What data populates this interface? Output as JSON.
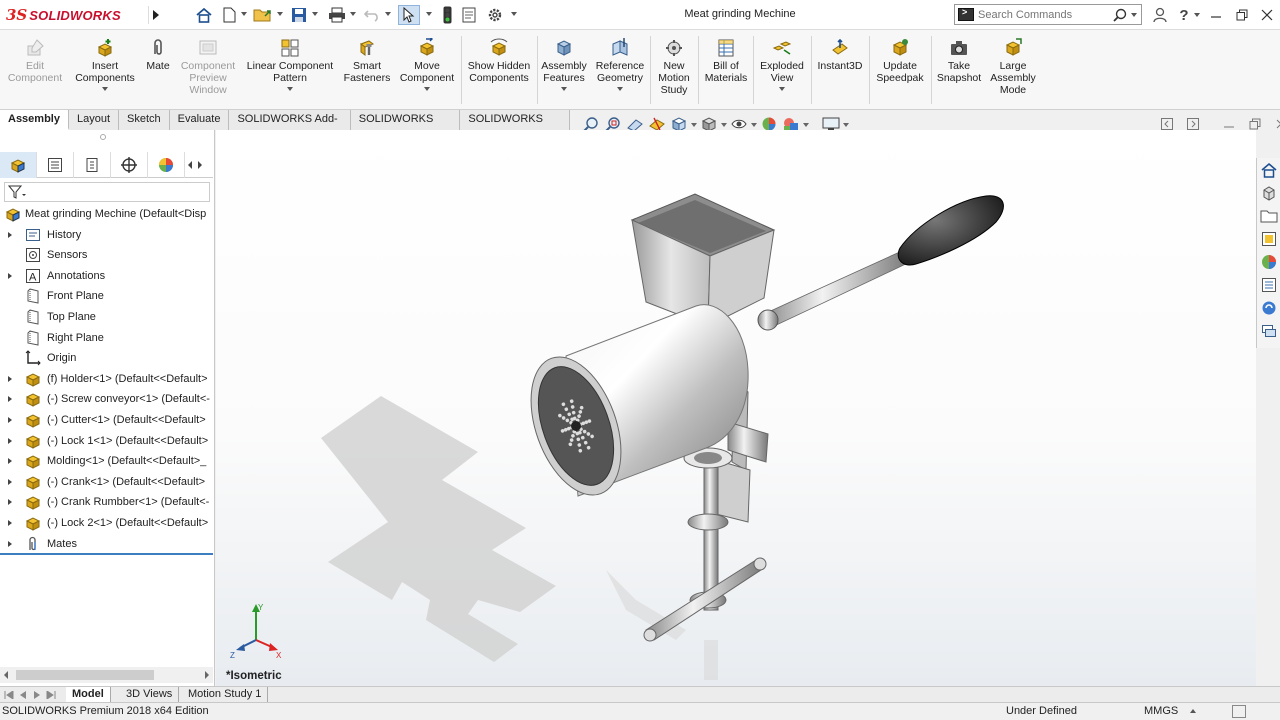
{
  "app": {
    "logo_prefix": "3S",
    "logo_name": "SOLIDWORKS",
    "document_title": "Meat grinding Mechine"
  },
  "search": {
    "placeholder": "Search Commands"
  },
  "toolbar": [
    {
      "label": "Edit Component",
      "icon": "edit-component-icon",
      "enabled": false
    },
    {
      "label": "Insert Components",
      "icon": "insert-components-icon",
      "enabled": true
    },
    {
      "label": "Mate",
      "icon": "mate-paperclip-icon",
      "enabled": true
    },
    {
      "label": "Component Preview Window",
      "icon": "preview-window-icon",
      "enabled": false
    },
    {
      "label": "Linear Component Pattern",
      "icon": "linear-pattern-icon",
      "enabled": true
    },
    {
      "label": "Smart Fasteners",
      "icon": "smart-fasteners-icon",
      "enabled": true
    },
    {
      "label": "Move Component",
      "icon": "move-component-icon",
      "enabled": true
    },
    {
      "label": "Show Hidden Components",
      "icon": "show-hidden-icon",
      "enabled": true
    },
    {
      "label": "Assembly Features",
      "icon": "assembly-features-icon",
      "enabled": true
    },
    {
      "label": "Reference Geometry",
      "icon": "reference-geometry-icon",
      "enabled": true
    },
    {
      "label": "New Motion Study",
      "icon": "motion-study-icon",
      "enabled": true
    },
    {
      "label": "Bill of Materials",
      "icon": "bom-icon",
      "enabled": true
    },
    {
      "label": "Exploded View",
      "icon": "exploded-view-icon",
      "enabled": true
    },
    {
      "label": "Instant3D",
      "icon": "instant3d-icon",
      "enabled": true
    },
    {
      "label": "Update Speedpak",
      "icon": "speedpak-icon",
      "enabled": true
    },
    {
      "label": "Take Snapshot",
      "icon": "camera-icon",
      "enabled": true
    },
    {
      "label": "Large Assembly Mode",
      "icon": "large-assembly-icon",
      "enabled": true
    }
  ],
  "tabs": [
    "Assembly",
    "Layout",
    "Sketch",
    "Evaluate",
    "SOLIDWORKS Add-Ins",
    "SOLIDWORKS MBD",
    "SOLIDWORKS CAM"
  ],
  "active_tab": "Assembly",
  "tree": {
    "root": "Meat grinding Mechine  (Default<Disp",
    "items": [
      {
        "label": "History",
        "expand": true,
        "icon": "history-icon"
      },
      {
        "label": "Sensors",
        "expand": false,
        "icon": "sensors-icon"
      },
      {
        "label": "Annotations",
        "expand": true,
        "icon": "annotations-icon"
      },
      {
        "label": "Front Plane",
        "expand": false,
        "icon": "plane-icon"
      },
      {
        "label": "Top Plane",
        "expand": false,
        "icon": "plane-icon"
      },
      {
        "label": "Right Plane",
        "expand": false,
        "icon": "plane-icon"
      },
      {
        "label": "Origin",
        "expand": false,
        "icon": "origin-icon"
      },
      {
        "label": "(f) Holder<1> (Default<<Default>",
        "expand": true,
        "icon": "part-icon"
      },
      {
        "label": "(-) Screw conveyor<1> (Default<-",
        "expand": true,
        "icon": "part-icon"
      },
      {
        "label": "(-) Cutter<1> (Default<<Default>",
        "expand": true,
        "icon": "part-icon"
      },
      {
        "label": "(-) Lock 1<1> (Default<<Default>",
        "expand": true,
        "icon": "part-icon"
      },
      {
        "label": "Molding<1> (Default<<Default>_",
        "expand": true,
        "icon": "part-icon"
      },
      {
        "label": "(-) Crank<1> (Default<<Default>",
        "expand": true,
        "icon": "part-icon"
      },
      {
        "label": "(-) Crank Rumbber<1> (Default<-",
        "expand": true,
        "icon": "part-icon"
      },
      {
        "label": "(-) Lock 2<1> (Default<<Default>",
        "expand": true,
        "icon": "part-icon"
      },
      {
        "label": "Mates",
        "expand": true,
        "icon": "mates-icon"
      }
    ]
  },
  "viewport": {
    "view_label": "*Isometric",
    "triad": {
      "x": "X",
      "y": "Y",
      "z": "Z"
    }
  },
  "bottom_tabs": [
    "Model",
    "3D Views",
    "Motion Study 1"
  ],
  "active_bottom_tab": "Model",
  "status": {
    "edition": "SOLIDWORKS Premium 2018 x64 Edition",
    "state": "Under Defined",
    "units": "MMGS"
  },
  "colors": {
    "brand_red": "#c8102e",
    "active_underline": "#3c7ebf",
    "part_yellow": "#e8b820"
  }
}
